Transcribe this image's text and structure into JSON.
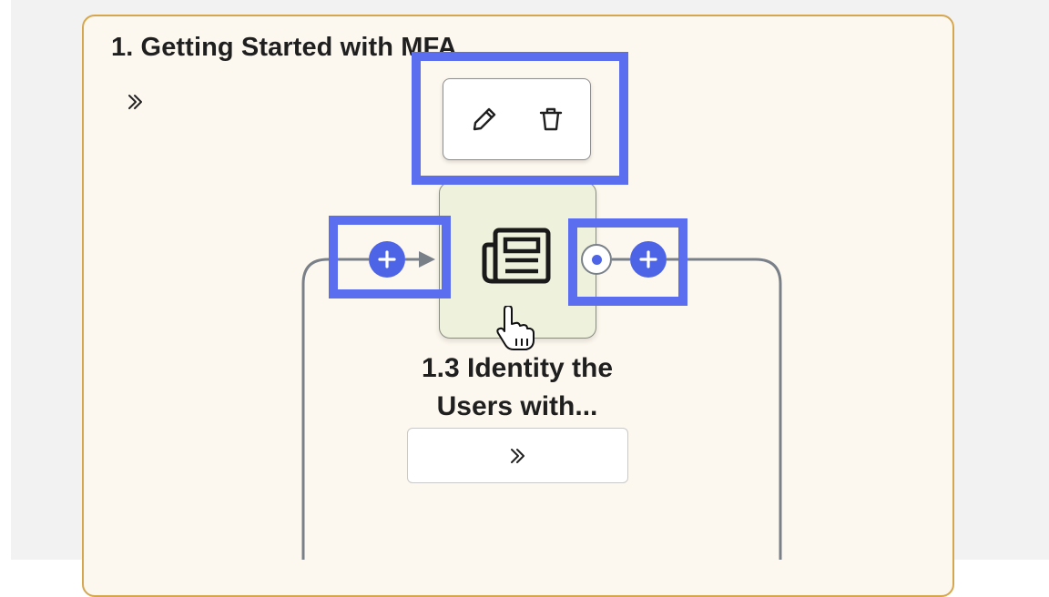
{
  "section": {
    "title": "1. Getting Started with MFA",
    "expand_icon": "double-chevron-right-icon"
  },
  "toolbar": {
    "edit_icon": "pencil-icon",
    "delete_icon": "trash-icon"
  },
  "node": {
    "icon": "newspaper-icon",
    "label_line1": "1.3 Identity the",
    "label_line2": "Users with...",
    "expand_icon": "double-chevron-right-icon"
  },
  "connectors": {
    "add_icon": "plus-icon",
    "dot_icon": "connector-dot-icon"
  },
  "cursor_icon": "hand-pointer-icon",
  "colors": {
    "accent": "#4d64e6",
    "highlight": "#5b6ef0",
    "section_border": "#d6a64f",
    "section_bg": "#fdf8ef",
    "node_bg": "#eef1dc",
    "connector_line": "#7a8088"
  }
}
